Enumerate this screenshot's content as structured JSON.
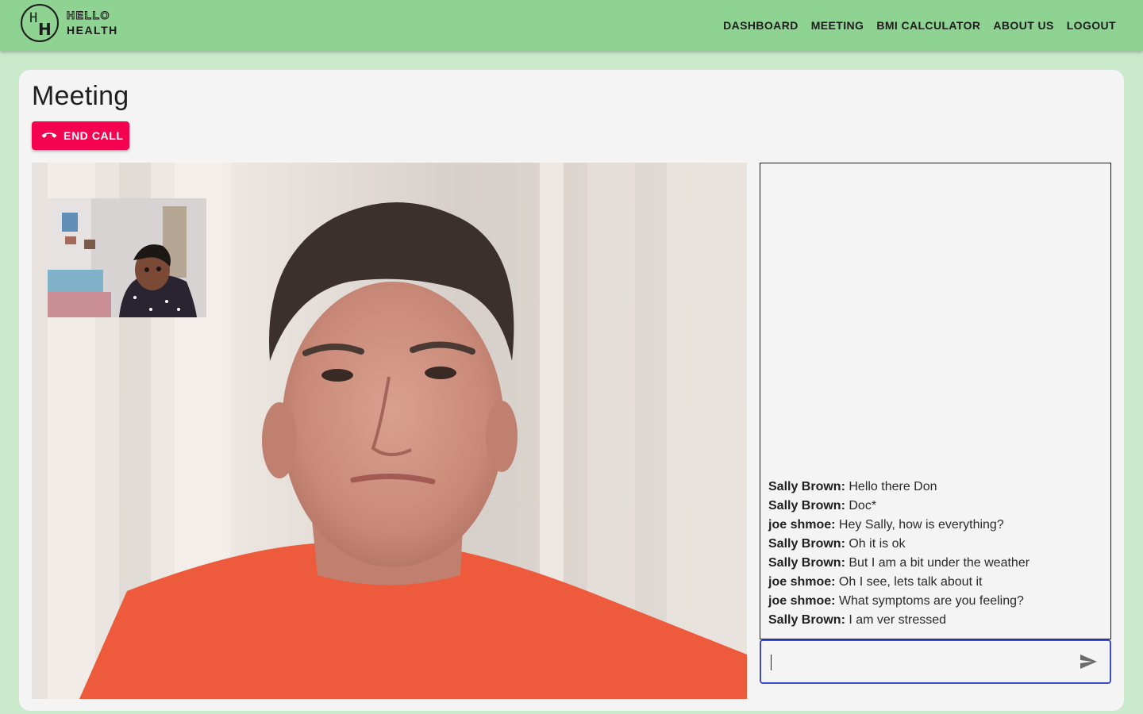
{
  "brand": {
    "monogram_top": "H",
    "monogram_bottom": "H",
    "line1": "HELLO",
    "line2": "HEALTH",
    "bar_color": "#8fd392"
  },
  "nav": {
    "items": [
      {
        "label": "DASHBOARD"
      },
      {
        "label": "MEETING"
      },
      {
        "label": "BMI CALCULATOR"
      },
      {
        "label": "ABOUT US"
      },
      {
        "label": "LOGOUT"
      }
    ]
  },
  "page": {
    "title": "Meeting",
    "end_call_label": "END CALL",
    "end_call_color": "#f40350",
    "end_call_icon": "phone-hangup-icon"
  },
  "video": {
    "remote_feed": "remote-participant-video",
    "local_feed": "self-view-video"
  },
  "chat": {
    "messages": [
      {
        "author": "Sally Brown:",
        "text": "Hello there Don"
      },
      {
        "author": "Sally Brown:",
        "text": "Doc*"
      },
      {
        "author": "joe shmoe:",
        "text": "Hey Sally, how is everything?"
      },
      {
        "author": "Sally Brown:",
        "text": "Oh it is ok"
      },
      {
        "author": "Sally Brown:",
        "text": "But I am a bit under the weather"
      },
      {
        "author": "joe shmoe:",
        "text": "Oh I see, lets talk about it"
      },
      {
        "author": "joe shmoe:",
        "text": "What symptoms are you feeling?"
      },
      {
        "author": "Sally Brown:",
        "text": "I am ver stressed"
      }
    ],
    "input_value": "",
    "send_icon": "send-icon",
    "focus_color": "#3f4dc4"
  }
}
